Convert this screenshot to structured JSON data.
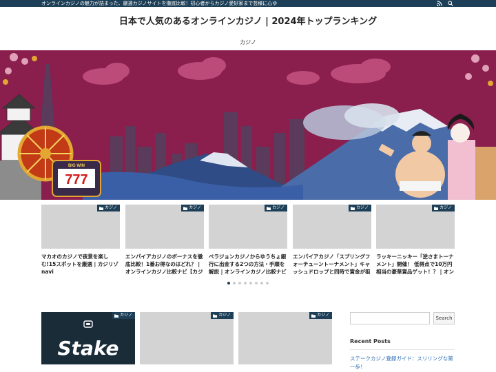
{
  "topbar": {
    "tagline": "オンラインカジノの魅力が詰まった、厳選カジノサイトを徹底比較！初心者からカジノ愛好家まで芸様に心ゆ",
    "icons": [
      "rss-icon",
      "search-icon"
    ]
  },
  "site_title": "日本で人気のあるオンラインカジノ | 2024年トップランキング",
  "nav": {
    "items": [
      "カジノ"
    ]
  },
  "hero": {
    "slot_sign": "BIG WIN",
    "slot_digits": "777"
  },
  "carousel": {
    "cards": [
      {
        "category": "カジノ",
        "title": "マカオのカジノで夜景を楽しむ!15スポットを厳選 | カジリゾnavi"
      },
      {
        "category": "カジノ",
        "title": "エンパイアカジノのボーナスを徹底比較！1番お得なのはどれ？ | オンラインカジノ比較ナビ【カジ"
      },
      {
        "category": "カジノ",
        "title": "ベラジョンカジノからゆうちょ銀行に出金する2つの方法・手順を解説 | オンラインカジノ比較ナビ"
      },
      {
        "category": "カジノ",
        "title": "エンパイアカジノ「スプリングフォーチューントーナメント」キャッシュドロップと同時で賞金が狙"
      },
      {
        "category": "カジノ",
        "title": "ラッキーニッキー「逆さまトーナメント」開催！ 低得点で10万円相当の豪華賞品ゲット！？ | オンラ"
      }
    ],
    "dot_count": 8,
    "active_dot": 0
  },
  "posts": [
    {
      "category": "カジノ",
      "image_text": "Stake"
    },
    {
      "category": "カジノ"
    },
    {
      "category": "カジノ"
    }
  ],
  "sidebar": {
    "search_placeholder": "",
    "search_button": "Search",
    "recent_title": "Recent Posts",
    "recent_items": [
      "ステークカジノ登録ガイド：スリリングな第一歩！"
    ]
  },
  "colors": {
    "topbar": "#1d3f57",
    "hero_bg": "#8a1e4c",
    "link": "#2a6bb5"
  }
}
